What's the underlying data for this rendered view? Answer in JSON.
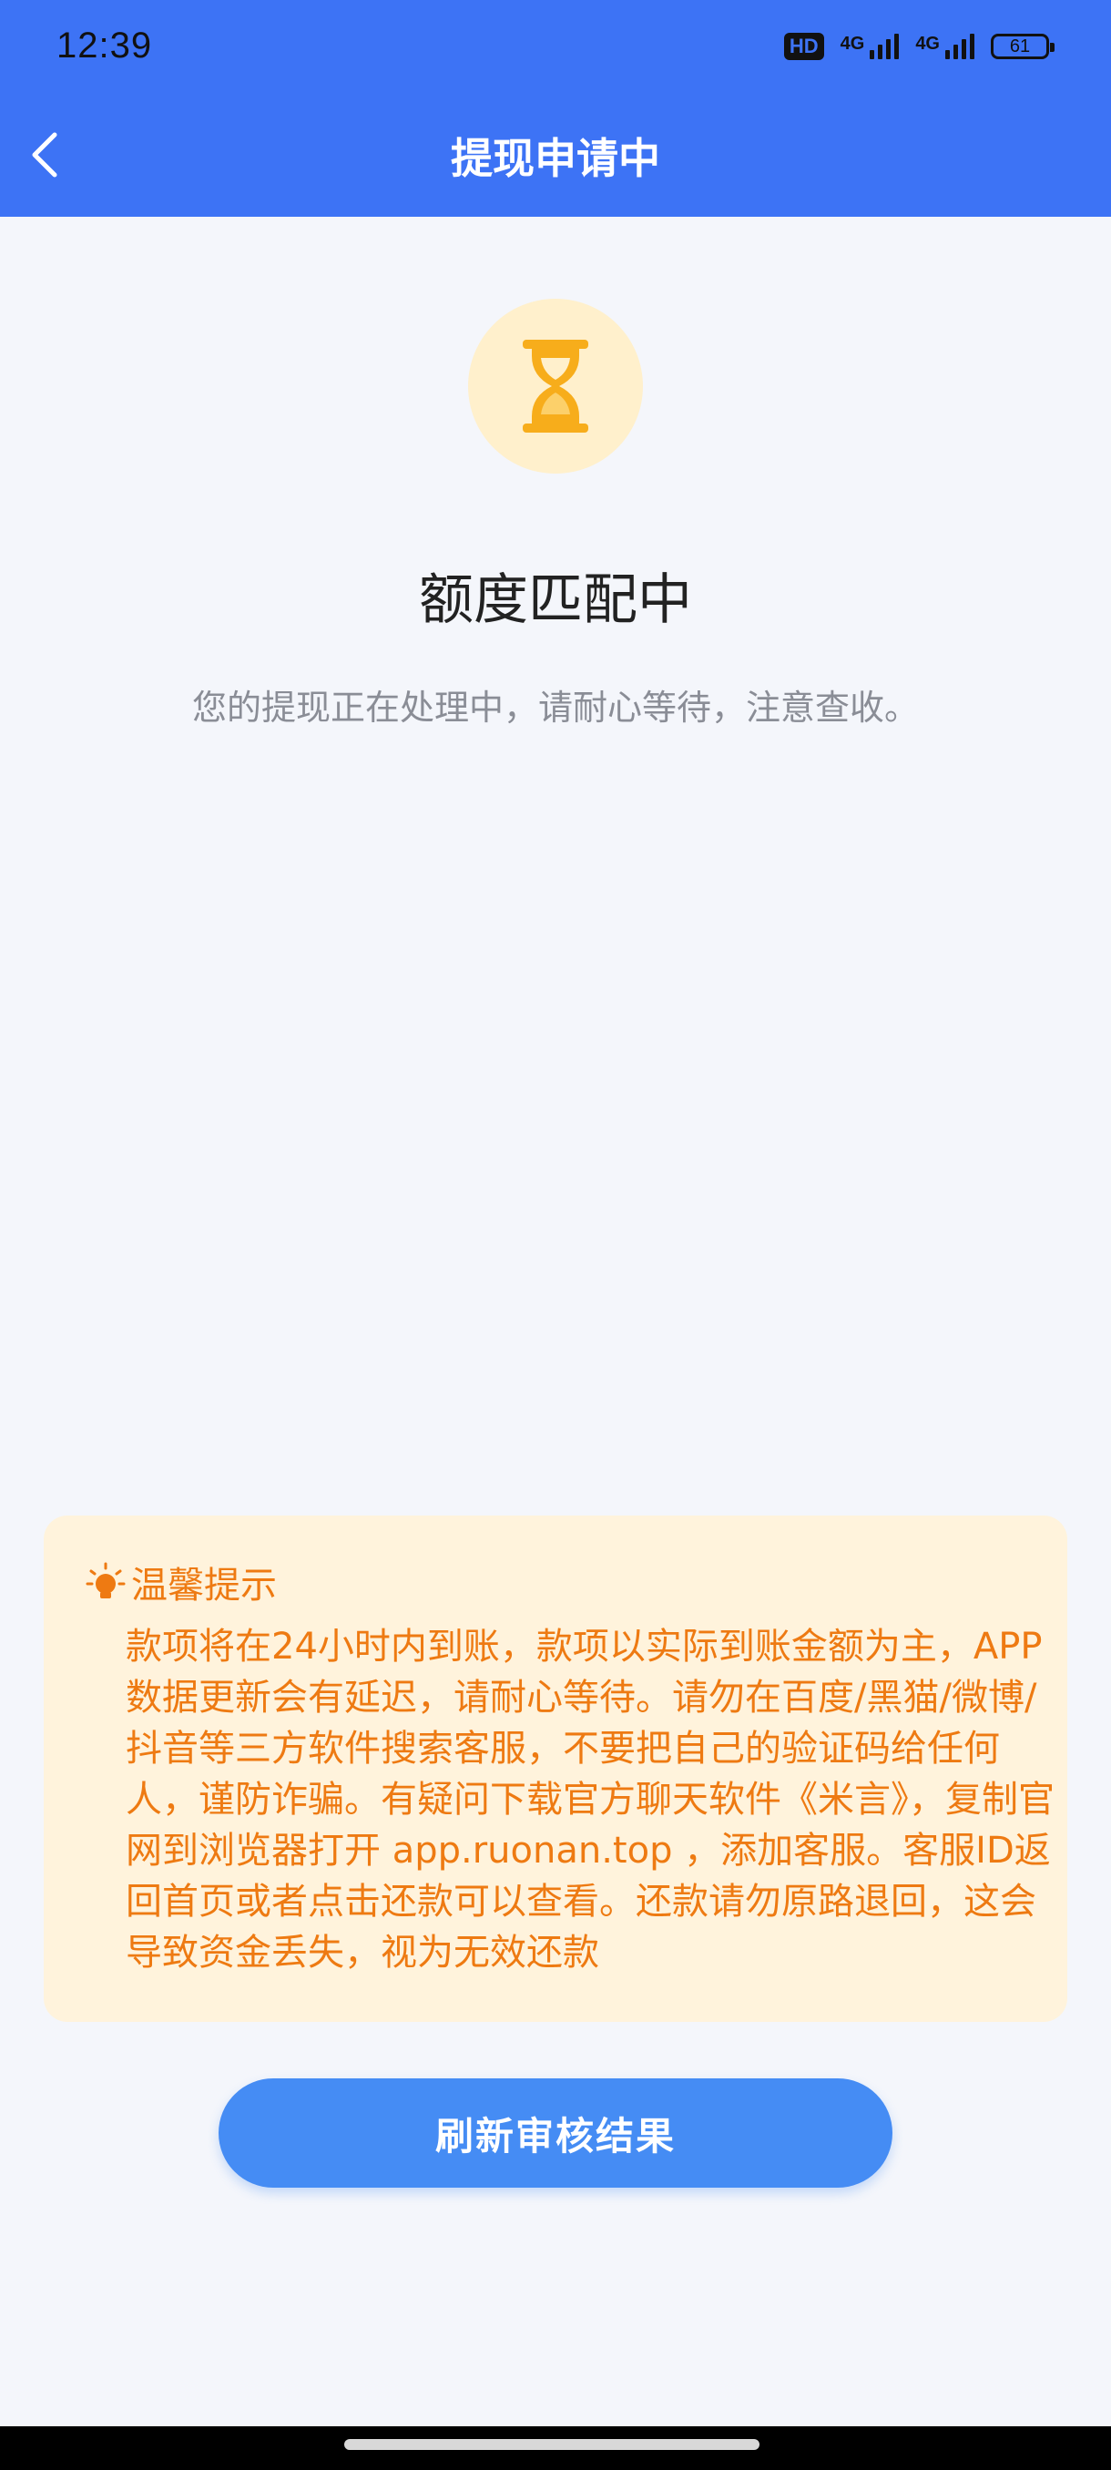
{
  "status_bar": {
    "time": "12:39",
    "hd_label": "HD",
    "network_1": "4G",
    "network_2": "4G",
    "battery": "61"
  },
  "header": {
    "title": "提现申请中",
    "back_icon": "chevron-left-icon"
  },
  "status": {
    "icon": "hourglass-icon",
    "heading": "额度匹配中",
    "description": "您的提现正在处理中，请耐心等待，注意查收。"
  },
  "tip": {
    "icon": "lightbulb-icon",
    "title": "温馨提示",
    "body": "款项将在24小时内到账，款项以实际到账金额为主，APP数据更新会有延迟，请耐心等待。请勿在百度/黑猫/微博/抖音等三方软件搜索客服，不要把自己的验证码给任何人，谨防诈骗。有疑问下载官方聊天软件《米言》，复制官网到浏览器打开 app.ruonan.top ，添加客服。客服ID返回首页或者点击还款可以查看。还款请勿原路退回，这会导致资金丢失，视为无效还款"
  },
  "actions": {
    "refresh_label": "刷新审核结果"
  },
  "colors": {
    "header_bg": "#3d73f5",
    "accent_button": "#458cf4",
    "tip_bg": "#fff3dc",
    "tip_text": "#ee7a12",
    "icon_circle": "#fff0cc",
    "icon_fill": "#f7ad1b"
  }
}
